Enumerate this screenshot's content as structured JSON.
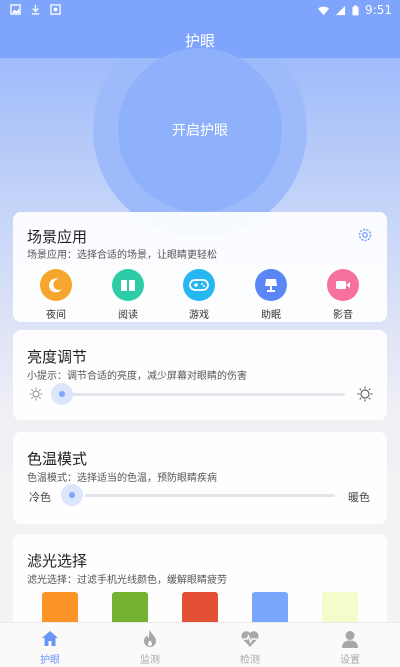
{
  "status_bar": {
    "time": "9:51",
    "left_icons": [
      "image-icon",
      "download-icon",
      "record-icon"
    ],
    "right_icons": [
      "wifi-icon",
      "signal-icon",
      "battery-icon"
    ]
  },
  "header": {
    "title": "护眼"
  },
  "hero": {
    "label": "开启护眼"
  },
  "scene": {
    "title": "场景应用",
    "subtitle": "场景应用：选择合适的场景，让眼睛更轻松",
    "items": [
      {
        "label": "夜间",
        "icon": "moon-icon",
        "color": "#f7a62d"
      },
      {
        "label": "阅读",
        "icon": "book-icon",
        "color": "#2dcca6"
      },
      {
        "label": "游戏",
        "icon": "gamepad-icon",
        "color": "#26b7f0"
      },
      {
        "label": "助眠",
        "icon": "lamp-icon",
        "color": "#5b86f7"
      },
      {
        "label": "影音",
        "icon": "video-icon",
        "color": "#f7719e"
      }
    ]
  },
  "brightness": {
    "title": "亮度调节",
    "subtitle": "小提示：调节合适的亮度，减少屏幕对眼睛的伤害",
    "value": 0
  },
  "color_temp": {
    "title": "色温模式",
    "subtitle": "色温模式：选择适当的色温，预防眼睛疾病",
    "min_label": "冷色",
    "max_label": "暖色",
    "value": 0
  },
  "filter": {
    "title": "滤光选择",
    "subtitle": "滤光选择：过滤手机光线颜色，缓解眼睛疲劳",
    "swatches": [
      "#fd9428",
      "#76b231",
      "#e34f34",
      "#7aa6fb",
      "#f6fbcc"
    ]
  },
  "tabbar": {
    "active_color": "#6a95f8",
    "inactive_color": "#a8a8a8",
    "tabs": [
      {
        "label": "护眼",
        "icon": "home-icon",
        "active": true
      },
      {
        "label": "监测",
        "icon": "flame-icon",
        "active": false
      },
      {
        "label": "检测",
        "icon": "heart-pulse-icon",
        "active": false
      },
      {
        "label": "设置",
        "icon": "user-icon",
        "active": false
      }
    ]
  }
}
